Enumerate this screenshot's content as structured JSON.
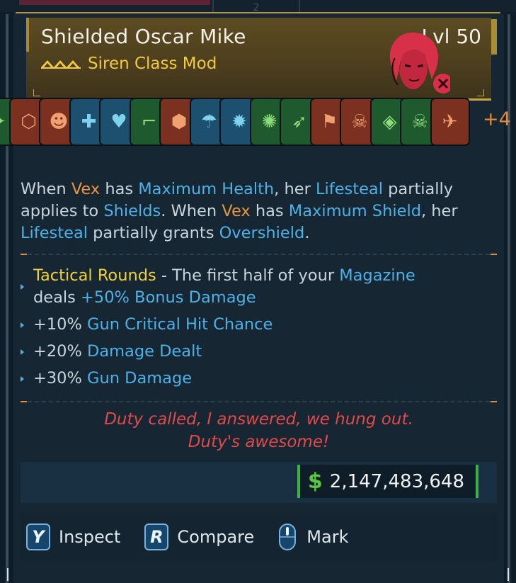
{
  "item": {
    "name": "Shielded Oscar Mike",
    "level": "Lvl 50",
    "subtype": "Siren Class Mod",
    "portrait_icon": "vex-portrait-icon",
    "rarity_icon": "legendary-chevrons-icon",
    "colors": {
      "header": "#4d3f1e",
      "accent_gold": "#c9a63e",
      "subtype": "#f2c93c"
    }
  },
  "perk_icons": [
    {
      "name": "perk-orange-star",
      "glyph": "✦",
      "bg": "#1f5a2e"
    },
    {
      "name": "perk-shield-orange",
      "glyph": "⬡",
      "bg": "#7c3020"
    },
    {
      "name": "perk-head-orange",
      "glyph": "☻",
      "bg": "#7c3020"
    },
    {
      "name": "perk-crossed-heal",
      "glyph": "✚",
      "bg": "#1d4f6e"
    },
    {
      "name": "perk-fist-heart",
      "glyph": "♥",
      "bg": "#1d4f6e"
    },
    {
      "name": "perk-pistol",
      "glyph": "⌐",
      "bg": "#1f5a2e"
    },
    {
      "name": "perk-shield-cycle",
      "glyph": "⬢",
      "bg": "#7c3020"
    },
    {
      "name": "perk-droplets",
      "glyph": "☂",
      "bg": "#1d4f6e"
    },
    {
      "name": "perk-burst",
      "glyph": "✹",
      "bg": "#1d4f6e"
    },
    {
      "name": "perk-splash",
      "glyph": "✺",
      "bg": "#1f5a2e"
    },
    {
      "name": "perk-bullet",
      "glyph": "➶",
      "bg": "#1f5a2e"
    },
    {
      "name": "perk-gun-head",
      "glyph": "⚑",
      "bg": "#7c3020"
    },
    {
      "name": "perk-skull-burst",
      "glyph": "☠",
      "bg": "#7c3020"
    },
    {
      "name": "perk-drop",
      "glyph": "◈",
      "bg": "#1f5a2e"
    },
    {
      "name": "perk-skull",
      "glyph": "☠",
      "bg": "#1f5a2e"
    },
    {
      "name": "perk-wings",
      "glyph": "✈",
      "bg": "#7c3020"
    }
  ],
  "more_perks": "+4",
  "description": {
    "w1": "When ",
    "vex1": "Vex",
    "w2": " has ",
    "mh": "Maximum Health",
    "w3": ", her ",
    "ls1": "Lifesteal",
    "w4": " partially applies to ",
    "sh": "Shields",
    "w5": ". When ",
    "vex2": "Vex",
    "w6": " has ",
    "ms": "Maximum Shield",
    "w7": ", her ",
    "ls2": "Lifesteal",
    "w8": " partially grants ",
    "os": "Overshield",
    "w9": "."
  },
  "bullets": {
    "b1_title": "Tactical Rounds",
    "b1_dash": " - The first half of your ",
    "b1_mag": "Magazine",
    "b1_deals": "deals ",
    "b1_bonus": "+50% Bonus Damage",
    "b2_pct": "+10% ",
    "b2_stat": "Gun Critical Hit Chance",
    "b3_pct": "+20% ",
    "b3_stat": "Damage Dealt",
    "b4_pct": "+30% ",
    "b4_stat": "Gun Damage"
  },
  "flavor": {
    "line1": "Duty called, I answered, we hung out.",
    "line2": "Duty's awesome!"
  },
  "price": {
    "symbol": "$",
    "value": "2,147,483,648"
  },
  "actions": [
    {
      "key": "Y",
      "label": "Inspect"
    },
    {
      "key": "R",
      "label": "Compare"
    },
    {
      "key": "",
      "label": "Mark"
    }
  ],
  "top_tab": "2"
}
